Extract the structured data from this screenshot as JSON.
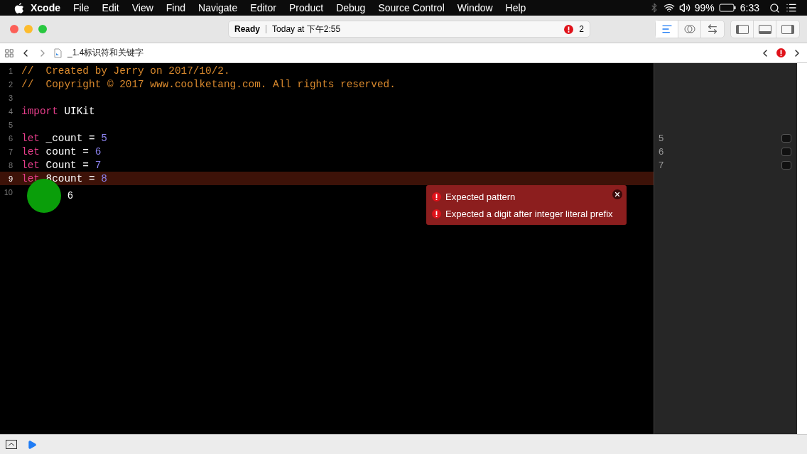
{
  "menubar": {
    "app": "Xcode",
    "items": [
      "File",
      "Edit",
      "View",
      "Find",
      "Navigate",
      "Editor",
      "Product",
      "Debug",
      "Source Control",
      "Window",
      "Help"
    ],
    "battery": "99%",
    "time": "6:33"
  },
  "toolbar": {
    "status": "Ready",
    "activity": "Today at 下午2:55",
    "issue_count": "2",
    "editor_modes": [
      {
        "kind": "standard",
        "selected": true
      },
      {
        "kind": "assistant",
        "selected": false
      },
      {
        "kind": "version",
        "selected": false
      }
    ]
  },
  "jumpbar": {
    "file": "_1.4标识符和关键字"
  },
  "editor": {
    "lines": [
      {
        "number": "1",
        "error": false,
        "tokens": [
          {
            "kind": "comment",
            "text": "//  Created by Jerry on 2017/10/2."
          }
        ]
      },
      {
        "number": "2",
        "error": false,
        "tokens": [
          {
            "kind": "comment",
            "text": "//  Copyright © 2017 www.coolketang.com. All rights reserved."
          }
        ]
      },
      {
        "number": "3",
        "error": false
      },
      {
        "number": "4",
        "error": false,
        "tokens": [
          {
            "kind": "keyword",
            "text": "import"
          },
          {
            "kind": "plain",
            "text": " UIKit"
          }
        ]
      },
      {
        "number": "5",
        "error": false
      },
      {
        "number": "6",
        "error": false,
        "result": "5",
        "tokens": [
          {
            "kind": "keyword",
            "text": "let"
          },
          {
            "kind": "plain",
            "text": " _count = "
          },
          {
            "kind": "number",
            "text": "5"
          }
        ]
      },
      {
        "number": "7",
        "error": false,
        "result": "6",
        "tokens": [
          {
            "kind": "keyword",
            "text": "let"
          },
          {
            "kind": "plain",
            "text": " count = "
          },
          {
            "kind": "number",
            "text": "6"
          }
        ]
      },
      {
        "number": "8",
        "error": false,
        "result": "7",
        "tokens": [
          {
            "kind": "keyword",
            "text": "let"
          },
          {
            "kind": "plain",
            "text": " Count = "
          },
          {
            "kind": "number",
            "text": "7"
          }
        ]
      },
      {
        "number": "9",
        "error": true,
        "tokens": [
          {
            "kind": "keyword",
            "text": "let"
          },
          {
            "kind": "plain",
            "text": " 8count = "
          },
          {
            "kind": "number",
            "text": "8"
          }
        ]
      },
      {
        "number": "10",
        "error": false
      }
    ],
    "issues": [
      "Expected pattern",
      "Expected a digit after integer literal prefix"
    ]
  },
  "tap_indicator": {
    "label": "6"
  }
}
